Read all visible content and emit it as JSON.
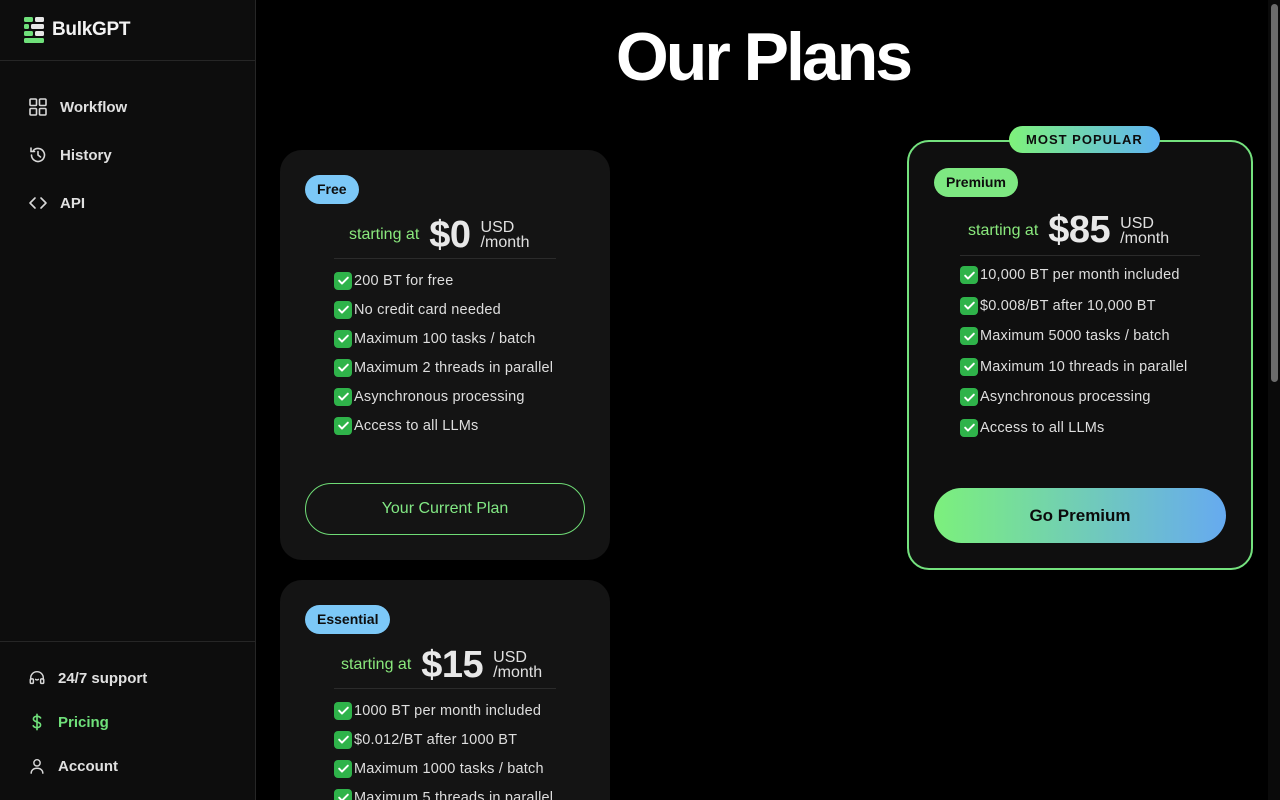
{
  "app": {
    "name": "BulkGPT"
  },
  "nav": {
    "items": [
      {
        "label": "Workflow",
        "icon": "grid-icon"
      },
      {
        "label": "History",
        "icon": "history-icon"
      },
      {
        "label": "API",
        "icon": "code-icon"
      }
    ],
    "bottom": [
      {
        "label": "24/7 support",
        "icon": "headset-icon"
      },
      {
        "label": "Pricing",
        "icon": "dollar-icon",
        "active": true
      },
      {
        "label": "Account",
        "icon": "user-icon"
      }
    ]
  },
  "page": {
    "title": "Our Plans"
  },
  "colors": {
    "accent_green": "#74e27e",
    "badge_blue": "#7cc8f7",
    "gradient_end": "#66aaf0"
  },
  "plans": {
    "free": {
      "name": "Free",
      "starting": "starting at",
      "price": "$0",
      "currency": "USD",
      "period": "/month",
      "features": [
        "200 BT for free",
        "No credit card needed",
        "Maximum 100 tasks / batch",
        "Maximum 2 threads in parallel",
        "Asynchronous processing",
        "Access to all LLMs"
      ],
      "button": "Your Current Plan"
    },
    "essential": {
      "name": "Essential",
      "starting": "starting at",
      "price": "$15",
      "currency": "USD",
      "period": "/month",
      "features": [
        "1000 BT per month included",
        "$0.012/BT after 1000 BT",
        "Maximum 1000 tasks / batch",
        "Maximum 5 threads in parallel"
      ]
    },
    "premium": {
      "tag": "MOST POPULAR",
      "name": "Premium",
      "starting": "starting at",
      "price": "$85",
      "currency": "USD",
      "period": "/month",
      "features": [
        "10,000 BT per month included",
        "$0.008/BT after 10,000 BT",
        "Maximum 5000 tasks / batch",
        "Maximum 10 threads in parallel",
        "Asynchronous processing",
        "Access to all LLMs"
      ],
      "button": "Go Premium"
    }
  }
}
